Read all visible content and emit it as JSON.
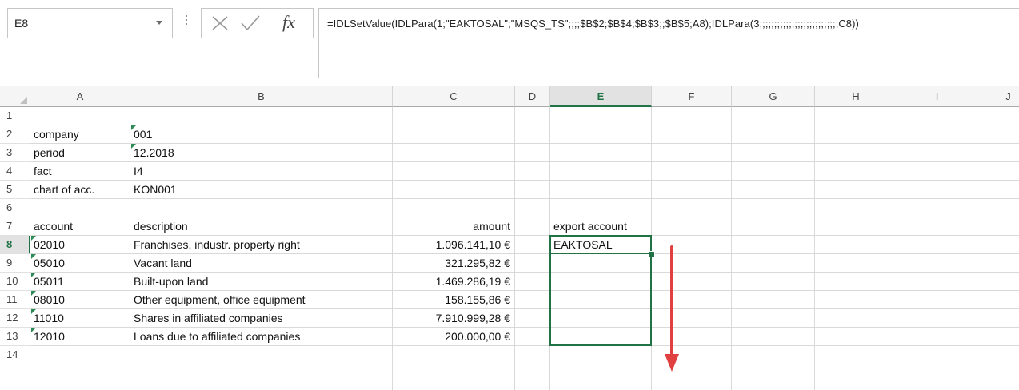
{
  "name_box": {
    "value": "E8"
  },
  "formula_bar": {
    "cancel_icon": "cross-icon",
    "enter_icon": "checkmark-icon",
    "fx_label": "fx",
    "formula": "=IDLSetValue(IDLPara(1;\"EAKTOSAL\";\"MSQS_TS\";;;;$B$2;$B$4;$B$3;;$B$5;A8);IDLPara(3;;;;;;;;;;;;;;;;;;;;;;;;;;;C8))"
  },
  "columns": [
    "A",
    "B",
    "C",
    "D",
    "E",
    "F",
    "G",
    "H",
    "I",
    "J"
  ],
  "selected_column": "E",
  "rows": [
    "1",
    "2",
    "3",
    "4",
    "5",
    "6",
    "7",
    "8",
    "9",
    "10",
    "11",
    "12",
    "13",
    "14"
  ],
  "selected_row": "8",
  "cells": {
    "A2": "company",
    "B2": "001",
    "A3": "period",
    "B3": "12.2018",
    "A4": "fact",
    "B4": "I4",
    "A5": "chart of acc.",
    "B5": "KON001",
    "A7": "account",
    "B7": "description",
    "C7": "amount",
    "E7": "export account",
    "A8": "02010",
    "B8": "Franchises, industr. property right",
    "C8": "1.096.141,10 €",
    "E8": "EAKTOSAL",
    "A9": "05010",
    "B9": "Vacant land",
    "C9": "321.295,82 €",
    "A10": "05011",
    "B10": "Built-upon land",
    "C10": "1.469.286,19 €",
    "A11": "08010",
    "B11": "Other equipment, office equipment",
    "C11": "158.155,86 €",
    "A12": "11010",
    "B12": "Shares in affiliated companies",
    "C12": "7.910.999,28 €",
    "A13": "12010",
    "B13": "Loans due to affiliated companies",
    "C13": "200.000,00 €"
  },
  "colors": {
    "selection": "#217346",
    "arrow": "#e0403f",
    "text_flag": "#2e8b57"
  },
  "annotation": {
    "type": "arrow",
    "direction": "down"
  }
}
